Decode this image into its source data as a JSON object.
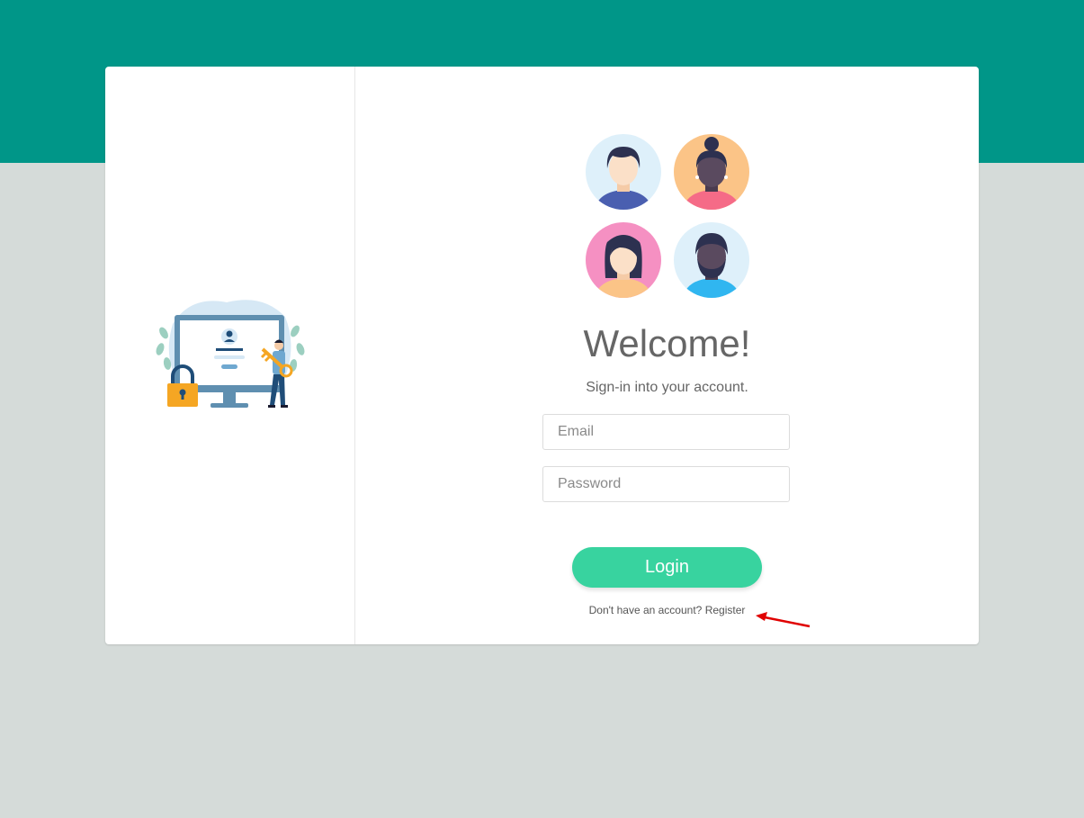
{
  "welcome_title": "Welcome!",
  "subtitle": "Sign-in into your account.",
  "email_placeholder": "Email",
  "password_placeholder": "Password",
  "login_label": "Login",
  "register_prompt": "Don't have an account?",
  "register_link": "Register",
  "colors": {
    "header_band": "#009688",
    "background": "#d5dbd9",
    "accent_button": "#38d39f",
    "annotation_arrow": "#e00000"
  },
  "icons": [
    "login-illustration",
    "avatar-man",
    "avatar-woman-bun",
    "avatar-woman",
    "avatar-bearded-man",
    "annotation-arrow"
  ]
}
